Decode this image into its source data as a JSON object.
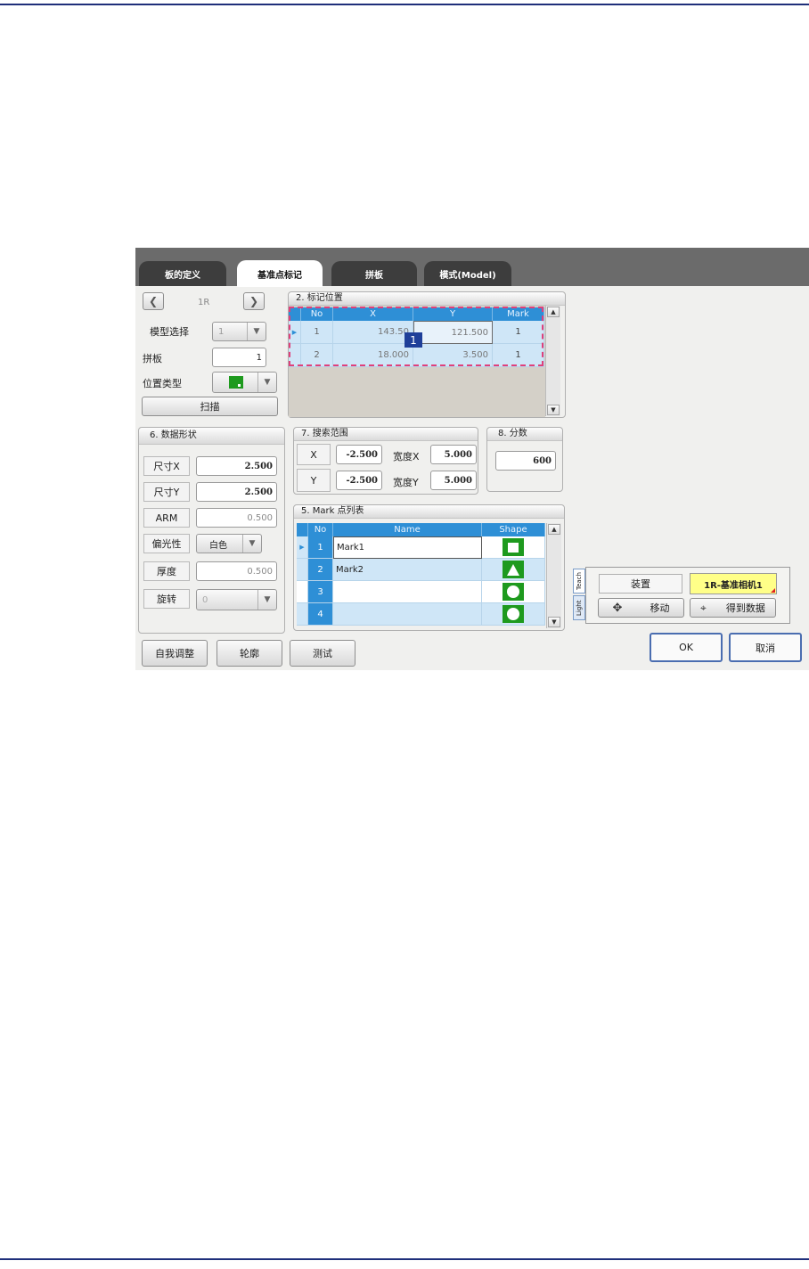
{
  "tabs": [
    {
      "label": "板的定义"
    },
    {
      "label": "基准点标记"
    },
    {
      "label": "拼板"
    },
    {
      "label": "模式(Model)"
    }
  ],
  "left_panel": {
    "prev_icon": "chevron-left-icon",
    "next_icon": "chevron-right-icon",
    "position_name": "1R",
    "model_select_label": "模型选择",
    "model_select_value": "1",
    "panel_label": "拼板",
    "panel_value": "1",
    "position_type_label": "位置类型",
    "scan_label": "扫描"
  },
  "mark_position": {
    "title": "2. 标记位置",
    "columns": [
      "No",
      "X",
      "Y",
      "Mark"
    ],
    "rows": [
      {
        "no": "1",
        "x": "143.50",
        "y": "121.500",
        "mark": "1"
      },
      {
        "no": "2",
        "x": "18.000",
        "y": "3.500",
        "mark": "1"
      }
    ],
    "callout": "1",
    "selection_color": "#e0407a"
  },
  "data_shape": {
    "title": "6. 数据形状",
    "size_x_label": "尺寸X",
    "size_x_value": "2.500",
    "size_y_label": "尺寸Y",
    "size_y_value": "2.500",
    "arm_label": "ARM",
    "arm_value": "0.500",
    "polarity_label": "偏光性",
    "polarity_value": "白色",
    "thickness_label": "厚度",
    "thickness_value": "0.500",
    "rotation_label": "旋转",
    "rotation_value": "0"
  },
  "search_range": {
    "title": "7. 搜索范围",
    "x_label": "X",
    "x_value": "-2.500",
    "width_x_label": "宽度X",
    "width_x_value": "5.000",
    "y_label": "Y",
    "y_value": "-2.500",
    "width_y_label": "宽度Y",
    "width_y_value": "5.000"
  },
  "score": {
    "title": "8. 分数",
    "value": "600"
  },
  "mark_list": {
    "title": "5. Mark 点列表",
    "columns": [
      "No",
      "Name",
      "Shape"
    ],
    "rows": [
      {
        "no": "1",
        "name": "Mark1",
        "shape": "square-icon"
      },
      {
        "no": "2",
        "name": "Mark2",
        "shape": "triangle-icon"
      },
      {
        "no": "3",
        "name": "",
        "shape": "circle-icon"
      },
      {
        "no": "4",
        "name": "",
        "shape": "circle-icon"
      }
    ]
  },
  "teach": {
    "tab_teach": "Teach",
    "tab_light": "Light",
    "device_label": "装置",
    "camera_label": "1R-基准相机1",
    "move_label": "移动",
    "move_icon": "move-arrows-icon",
    "get_data_label": "得到数据",
    "get_data_icon": "target-icon"
  },
  "bottom_buttons": {
    "self_adjust": "自我调整",
    "contour": "轮廓",
    "test": "测试",
    "ok": "OK",
    "cancel": "取消"
  },
  "colors": {
    "header_blue": "#2e8fd6",
    "row_selected": "#cfe6f7",
    "shape_green": "#1e9a1e",
    "camera_yellow": "#ffff88",
    "tab_dark": "#3d3d3d"
  }
}
